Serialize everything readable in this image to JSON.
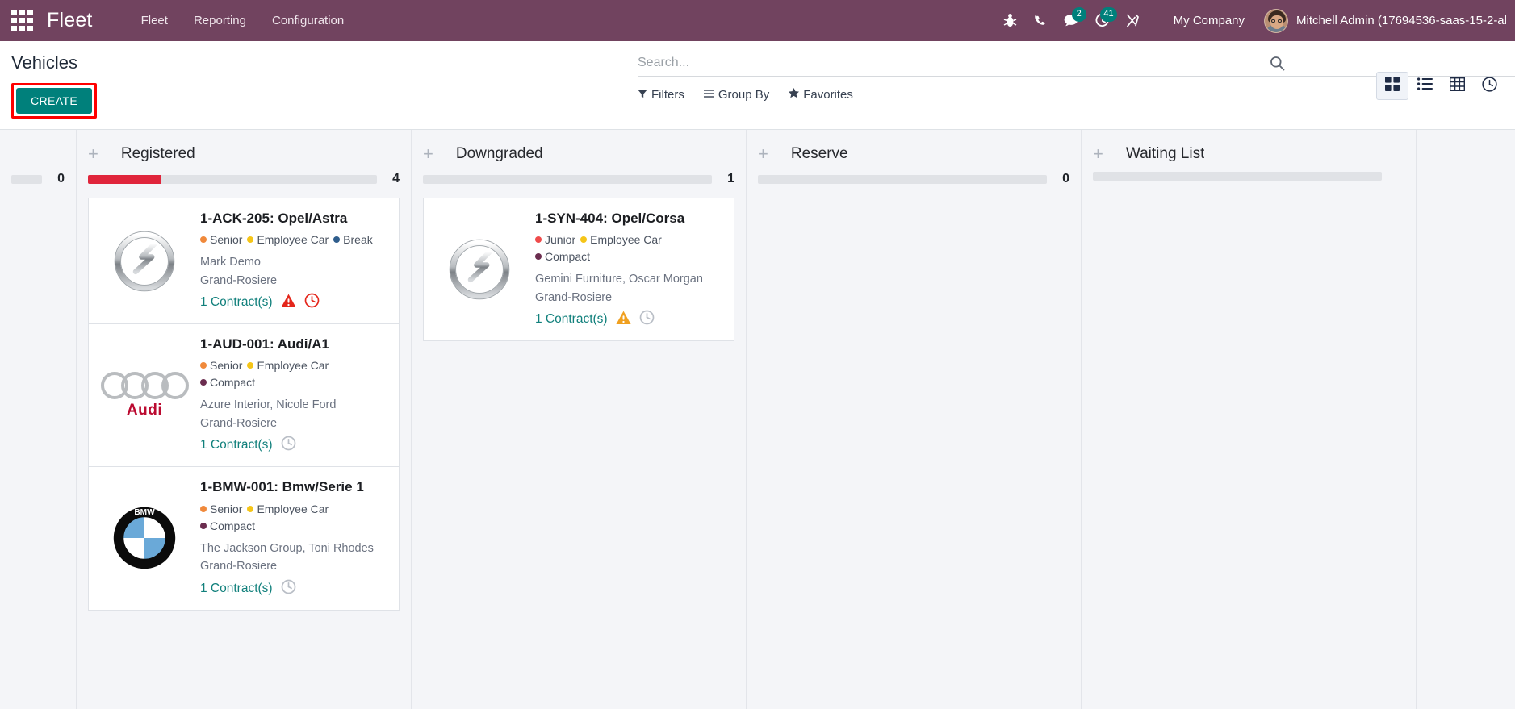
{
  "navbar": {
    "apps_icon": "apps-grid-icon",
    "brand": "Fleet",
    "menus": [
      "Fleet",
      "Reporting",
      "Configuration"
    ],
    "icons": [
      {
        "name": "bug-icon",
        "badge": null
      },
      {
        "name": "phone-icon",
        "badge": null
      },
      {
        "name": "messages-icon",
        "badge": "2"
      },
      {
        "name": "activities-clock-icon",
        "badge": "41"
      },
      {
        "name": "tools-icon",
        "badge": null
      }
    ],
    "company": "My Company",
    "user": "Mitchell Admin (17694536-saas-15-2-al",
    "bg_color": "#71435f",
    "badge_color": "#00807b"
  },
  "control_panel": {
    "title": "Vehicles",
    "create_label": "CREATE",
    "create_color": "#00807b",
    "highlight_color": "#ff0000",
    "search_placeholder": "Search...",
    "search_value": "",
    "filters": [
      {
        "name": "filters",
        "label": "Filters",
        "icon": "funnel-icon"
      },
      {
        "name": "group-by",
        "label": "Group By",
        "icon": "bars-icon"
      },
      {
        "name": "favorites",
        "label": "Favorites",
        "icon": "star-icon"
      }
    ],
    "views": [
      {
        "name": "kanban-view",
        "icon": "kanban-icon",
        "active": true
      },
      {
        "name": "list-view",
        "icon": "list-icon",
        "active": false
      },
      {
        "name": "pivot-view",
        "icon": "grid-table-icon",
        "active": false
      },
      {
        "name": "activity-view",
        "icon": "clock-icon",
        "active": false
      }
    ]
  },
  "kanban": {
    "columns": [
      {
        "name": "column-clipped",
        "title": "",
        "count": "0",
        "clipped": true,
        "progress": [],
        "cards": []
      },
      {
        "name": "column-registered",
        "title": "Registered",
        "count": "4",
        "clipped": false,
        "progress": [
          {
            "color": "#e0253b",
            "pct": 25
          }
        ],
        "cards": [
          {
            "name": "vehicle-card-opel-astra",
            "logo": "opel-logo",
            "title": "1-ACK-205: Opel/Astra",
            "tags": [
              {
                "label": "Senior",
                "color": "#f0893b"
              },
              {
                "label": "Employee Car",
                "color": "#f5c518"
              },
              {
                "label": "Break",
                "color": "#2f5d8c"
              }
            ],
            "driver": "Mark Demo",
            "location": "Grand-Rosiere",
            "contract": "1 Contract(s)",
            "icons": [
              {
                "name": "warning-triangle-icon",
                "color": "#e4261b"
              },
              {
                "name": "clock-alert-icon",
                "color": "#e4261b"
              }
            ]
          },
          {
            "name": "vehicle-card-audi-a1",
            "logo": "audi-logo",
            "title": "1-AUD-001: Audi/A1",
            "tags": [
              {
                "label": "Senior",
                "color": "#f0893b"
              },
              {
                "label": "Employee Car",
                "color": "#f5c518"
              },
              {
                "label": "Compact",
                "color": "#6b2d4f"
              }
            ],
            "driver": "Azure Interior, Nicole Ford",
            "location": "Grand-Rosiere",
            "contract": "1 Contract(s)",
            "icons": [
              {
                "name": "clock-icon",
                "color": "#b9bec6"
              }
            ]
          },
          {
            "name": "vehicle-card-bmw-serie1",
            "logo": "bmw-logo",
            "title": "1-BMW-001: Bmw/Serie 1",
            "tags": [
              {
                "label": "Senior",
                "color": "#f0893b"
              },
              {
                "label": "Employee Car",
                "color": "#f5c518"
              },
              {
                "label": "Compact",
                "color": "#6b2d4f"
              }
            ],
            "driver": "The Jackson Group, Toni Rhodes",
            "location": "Grand-Rosiere",
            "contract": "1 Contract(s)",
            "icons": [
              {
                "name": "clock-icon",
                "color": "#b9bec6"
              }
            ]
          }
        ]
      },
      {
        "name": "column-downgraded",
        "title": "Downgraded",
        "count": "1",
        "clipped": false,
        "progress": [],
        "cards": [
          {
            "name": "vehicle-card-opel-corsa",
            "logo": "opel-logo",
            "title": "1-SYN-404: Opel/Corsa",
            "tags": [
              {
                "label": "Junior",
                "color": "#ef4b4b"
              },
              {
                "label": "Employee Car",
                "color": "#f5c518"
              },
              {
                "label": "Compact",
                "color": "#6b2d4f"
              }
            ],
            "driver": "Gemini Furniture, Oscar Morgan",
            "location": "Grand-Rosiere",
            "contract": "1 Contract(s)",
            "icons": [
              {
                "name": "warning-triangle-icon",
                "color": "#f0a020"
              },
              {
                "name": "clock-icon",
                "color": "#b9bec6"
              }
            ]
          }
        ]
      },
      {
        "name": "column-reserve",
        "title": "Reserve",
        "count": "0",
        "clipped": false,
        "progress": [],
        "cards": []
      },
      {
        "name": "column-waiting-list",
        "title": "Waiting List",
        "count": "",
        "clipped": false,
        "progress": [],
        "cards": []
      }
    ]
  }
}
